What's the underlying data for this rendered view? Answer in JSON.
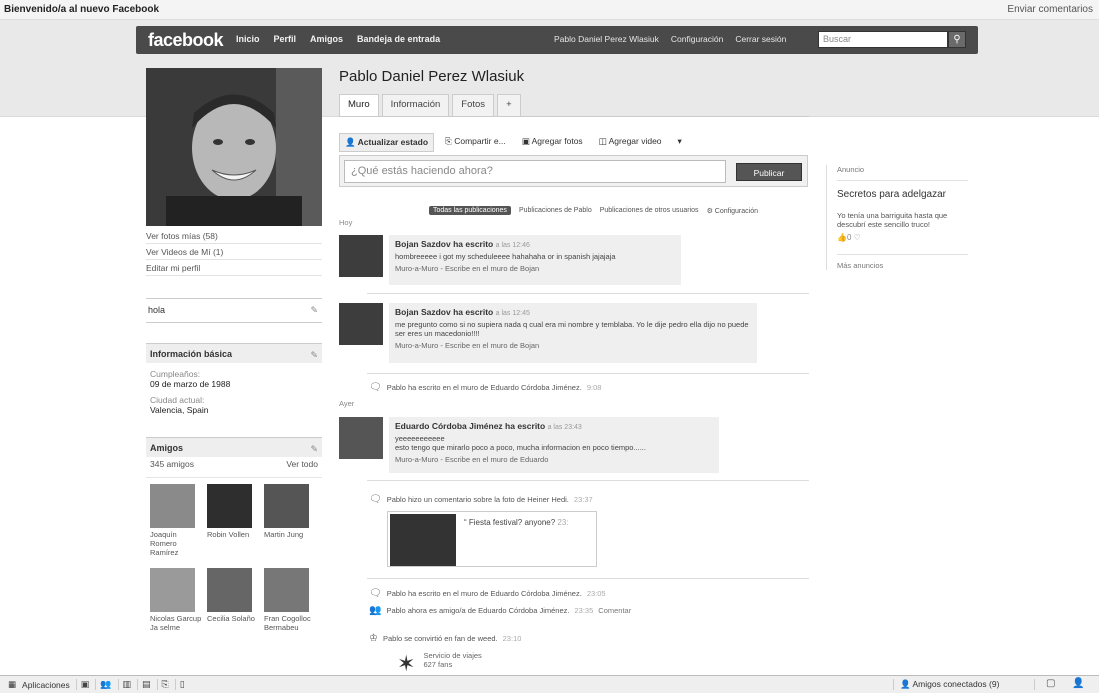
{
  "window": {
    "title": "Bienvenido/a al nuevo Facebook",
    "feedback": "Enviar comentarios"
  },
  "header": {
    "logo": "facebook",
    "nav": [
      "Inicio",
      "Perfil",
      "Amigos",
      "Bandeja de entrada"
    ],
    "user": "Pablo Daniel Perez Wlasiuk",
    "settings": "Configuración",
    "logout": "Cerrar sesión",
    "search_placeholder": "Buscar"
  },
  "profile": {
    "name": "Pablo Daniel Perez Wlasiuk",
    "links": [
      "Ver fotos mías (58)",
      "Ver Videos de Mí (1)",
      "Editar mi perfil"
    ],
    "status": "hola",
    "info_title": "Información básica",
    "birthday_label": "Cumpleaños:",
    "birthday": "09 de marzo de 1988",
    "city_label": "Ciudad actual:",
    "city": "Valencia, Spain",
    "friends_title": "Amigos",
    "friends_count": "345 amigos",
    "friends_see_all": "Ver todo",
    "friends": [
      {
        "name": "Joaquín Romero Ramírez"
      },
      {
        "name": "Robin Vollen"
      },
      {
        "name": "Martin Jung"
      },
      {
        "name": "Nicolas Garcup Ja selme"
      },
      {
        "name": "Cecilia Solaño"
      },
      {
        "name": "Fran Cogolloc Bermabeu"
      }
    ]
  },
  "tabs": [
    "Muro",
    "Información",
    "Fotos",
    "+"
  ],
  "actions": [
    "Actualizar estado",
    "Compartir e...",
    "Agregar fotos",
    "Agregar video",
    "▾"
  ],
  "composer": {
    "placeholder": "¿Qué estás haciendo ahora?",
    "publish": "Publicar"
  },
  "filters": [
    "Todas las publicaciones",
    "Publicaciones de Pablo",
    "Publicaciones de otros usuarios",
    "⚙ Configuración"
  ],
  "days": {
    "today": "Hoy",
    "yesterday": "Ayer"
  },
  "posts": [
    {
      "author": "Bojan Sazdov ha escrito",
      "time": "a las 12:46",
      "text": "hombreeeee i got my scheduleeee hahahaha or in spanish jajajaja",
      "meta": "Muro-a-Muro - Escribe en el muro de Bojan"
    },
    {
      "author": "Bojan Sazdov ha escrito",
      "time": "a las 12:45",
      "text": "me pregunto como si no supiera nada q cual era mi nombre y temblaba. Yo le dije pedro ella dijo no puede ser eres un macedonio!!!!",
      "meta": "Muro-a-Muro - Escribe en el muro de Bojan"
    },
    {
      "author": "Eduardo Córdoba Jiménez ha escrito",
      "time": "a las 23:43",
      "text": "yeeeeeeeeeee",
      "text2": "esto tengo que mirarlo poco a poco, mucha informacion en poco tiempo......",
      "meta": "Muro-a-Muro - Escribe en el muro de Eduardo"
    }
  ],
  "stories": {
    "s1": "Pablo ha escrito en el muro de Eduardo Córdoba Jiménez.",
    "s1_time": "9:08",
    "s2": "Pablo hizo un comentario sobre la foto de Heiner Hedi.",
    "s2_time": "23:37",
    "photo_caption": "Fiesta festival? anyone?",
    "photo_time": "23:",
    "s3": "Pablo ha escrito en el muro de Eduardo Córdoba Jiménez.",
    "s3_time": "23:05",
    "s4": "Pablo ahora es amigo/a de Eduardo Córdoba Jiménez.",
    "s4_time": "23:35",
    "s4_link": "Comentar",
    "s5": "Pablo se convirtió en fan de weed.",
    "s5_time": "23:10",
    "page_name": "Servicio de viajes",
    "page_fans": "627 fans"
  },
  "ads": {
    "header": "Anuncio",
    "title": "Secretos para adelgazar",
    "body": "Yo tenía una barriguita hasta que descubrí este sencillo truco!",
    "like": "👍0 ♡",
    "more": "Más anuncios"
  },
  "bottombar": {
    "apps": "Aplicaciones",
    "chat": "Amigos conectados (9)"
  }
}
